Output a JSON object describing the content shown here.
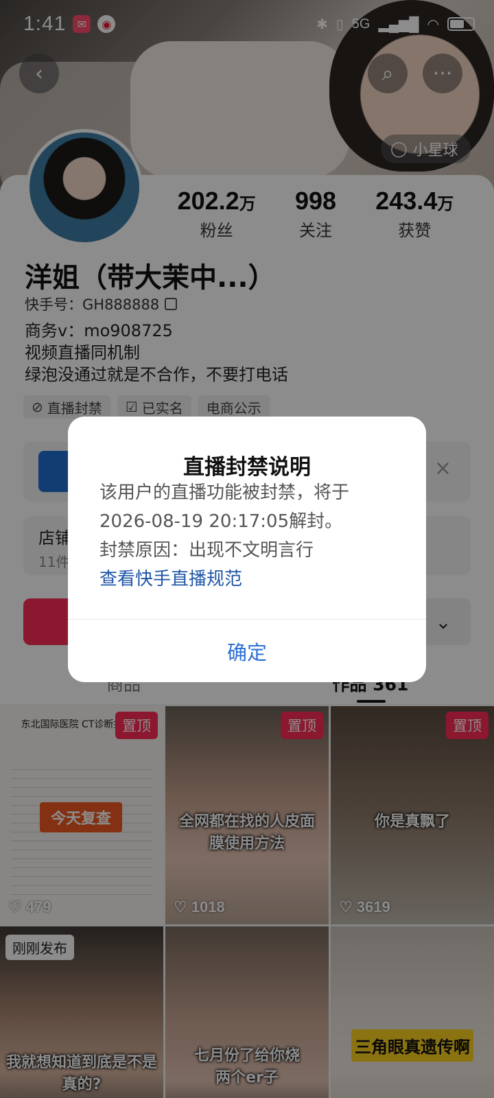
{
  "status_bar": {
    "time": "1:41",
    "network": "5G"
  },
  "header": {
    "planet_label": "小星球"
  },
  "profile": {
    "name": "洋姐（带大茉中...）",
    "kuaishou_id": "快手号：GH888888",
    "bio_lines": [
      "商务v：mo908725",
      "视频直播同机制",
      "绿泡没通过就是不合作，不要打电话"
    ],
    "stats": [
      {
        "value": "202.2",
        "unit": "万",
        "label": "粉丝"
      },
      {
        "value": "998",
        "unit": "",
        "label": "关注"
      },
      {
        "value": "243.4",
        "unit": "万",
        "label": "获赞"
      }
    ],
    "tags": [
      "直播封禁",
      "已实名",
      "电商公示"
    ]
  },
  "shop": {
    "title": "店铺",
    "subtitle": "11件"
  },
  "tabs": [
    {
      "label": "商品"
    },
    {
      "label": "作品 361"
    }
  ],
  "videos": [
    {
      "pinned": "置顶",
      "likes": "479",
      "doc_title": "东北国际医院 CT诊断报告单",
      "doc_button": "今天复查"
    },
    {
      "pinned": "置顶",
      "likes": "1018",
      "caption": "全网都在找的人皮面膜使用方法"
    },
    {
      "pinned": "置顶",
      "likes": "3619",
      "caption": "你是真飘了"
    },
    {
      "badge": "刚刚发布",
      "caption": "我就想知道到底是不是真的?"
    },
    {
      "caption": "七月份了给你烧两个er子"
    },
    {
      "caption": "三角眼真遗传啊"
    }
  ],
  "dialog": {
    "title": "直播封禁说明",
    "line1": "该用户的直播功能被封禁，将于",
    "line2": "2026-08-19 20:17:05解封。",
    "line3": "封禁原因：出现不文明言行",
    "link": "查看快手直播规范",
    "confirm": "确定"
  },
  "colors": {
    "accent": "#fe2c55",
    "link": "#1f55a8",
    "confirm": "#2c6fd6"
  }
}
